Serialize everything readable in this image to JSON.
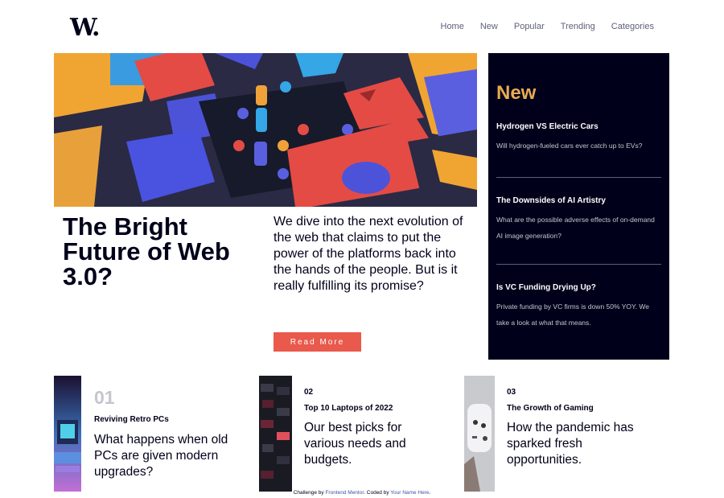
{
  "logo": "W.",
  "nav": [
    "Home",
    "New",
    "Popular",
    "Trending",
    "Categories"
  ],
  "hero": {
    "title": "The Bright Future of Web 3.0?",
    "description": "We dive into the next evolution of the web that claims to put the power of the platforms back into the hands of the people. But is it really fulfilling its promise?",
    "button": "Read More"
  },
  "new_panel": {
    "title": "New",
    "items": [
      {
        "title": "Hydrogen VS Electric Cars",
        "desc": "Will hydrogen-fueled cars ever catch up to EVs?"
      },
      {
        "title": "The Downsides of AI Artistry",
        "desc": "What are the possible adverse effects of on-demand AI image generation?"
      },
      {
        "title": "Is VC Funding Drying Up?",
        "desc": "Private funding by VC firms is down 50% YOY. We take a look at what that means."
      }
    ]
  },
  "cards": [
    {
      "num": "01",
      "title": "Reviving Retro PCs",
      "desc": "What happens when old PCs are given modern upgrades?"
    },
    {
      "num": "02",
      "title": "Top 10 Laptops of 2022",
      "desc": "Our best picks for various needs and budgets."
    },
    {
      "num": "03",
      "title": "The Growth of Gaming",
      "desc": "How the pandemic has sparked fresh opportunities."
    }
  ],
  "footer": {
    "prefix": "Challenge by ",
    "link1": "Frontend Mentor",
    "middle": ". Coded by ",
    "link2": "Your Name Here",
    "suffix": "."
  },
  "colors": {
    "accent_red": "#e9594c",
    "accent_orange": "#e9ab53",
    "dark_navy": "#00001a",
    "grey_blue": "#5d5f79"
  }
}
